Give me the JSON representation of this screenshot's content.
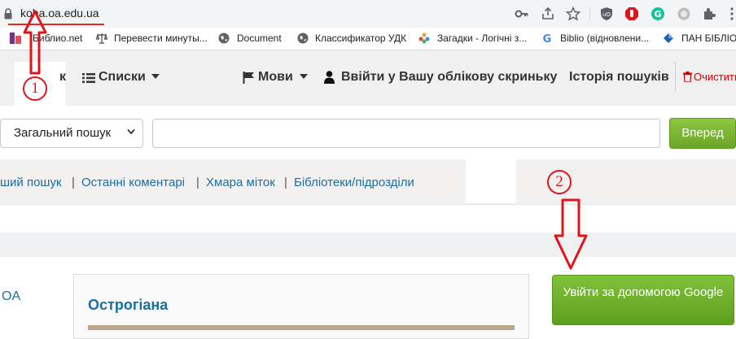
{
  "browser": {
    "url": "koha.oa.edu.ua",
    "bookmarks": [
      {
        "label": "Библио.net",
        "icon": "biblio-icon"
      },
      {
        "label": "Перевести минуты...",
        "icon": "scales-icon"
      },
      {
        "label": "Document",
        "icon": "globe-icon"
      },
      {
        "label": "Классификатор УДК",
        "icon": "globe-icon"
      },
      {
        "label": "Загадки - Логічні з...",
        "icon": "puzzle-flower-icon"
      },
      {
        "label": "Biblio (відновлени...",
        "icon": "google-g-icon"
      },
      {
        "label": "ПАН БІБЛІОТ",
        "icon": "diamond-icon"
      }
    ]
  },
  "nav": {
    "cut_letter": "к",
    "lists": "Списки",
    "languages": "Мови",
    "login": "Ввійти у Вашу облікову скриньку",
    "history": "Історія пошуків",
    "clear": "Очистити"
  },
  "search": {
    "select_value": "Загальний пошук",
    "input_value": "",
    "go_label": "Вперед"
  },
  "links": {
    "advanced": "ший пошук",
    "recent_comments": "Останні коментарі",
    "tag_cloud": "Хмара міток",
    "libraries": "Бібліотеки/підрозділи"
  },
  "content": {
    "left_text": "OA",
    "card_title": "Острогіана",
    "google_login": "Увійти за допомогою Google"
  },
  "annotations": {
    "marker1": "1",
    "marker2": "2",
    "color": "#e0141b"
  },
  "colors": {
    "accent_green": "#7ab532",
    "link_blue": "#1a6ea2"
  }
}
